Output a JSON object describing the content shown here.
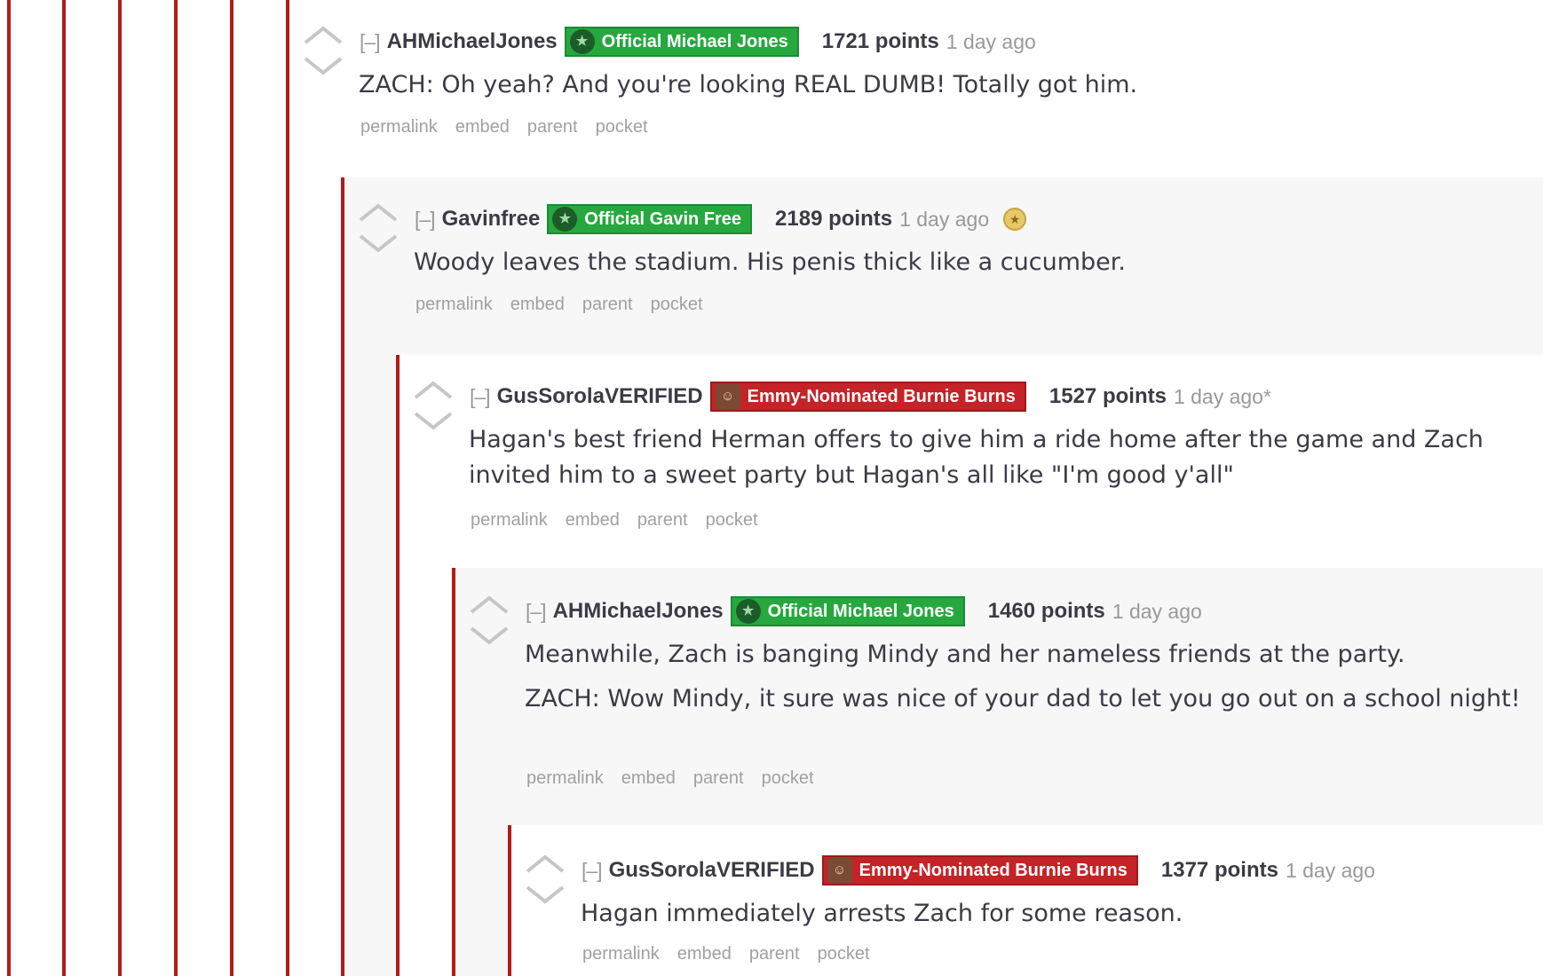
{
  "comments": [
    {
      "collapse": "[–]",
      "author": "AHMichaelJones",
      "flair": "Official Michael Jones",
      "flair_color": "#26a83f",
      "points": "1721 points",
      "time": "1 day ago",
      "body": [
        "ZACH: Oh yeah? And you're looking REAL DUMB! Totally got him."
      ],
      "actions": [
        "permalink",
        "embed",
        "parent",
        "pocket"
      ]
    },
    {
      "collapse": "[–]",
      "author": "Gavinfree",
      "flair": "Official Gavin Free",
      "flair_color": "#26a83f",
      "points": "2189 points",
      "time": "1 day ago",
      "body": [
        "Woody leaves the stadium. His penis thick like a cucumber."
      ],
      "actions": [
        "permalink",
        "embed",
        "parent",
        "pocket"
      ]
    },
    {
      "collapse": "[–]",
      "author": "GusSorolaVERIFIED",
      "flair": "Emmy-Nominated Burnie Burns",
      "flair_color": "#c42327",
      "points": "1527 points",
      "time": "1 day ago*",
      "body": [
        "Hagan's best friend Herman offers to give him a ride home after the game and Zach invited him to a sweet party but Hagan's all like \"I'm good y'all\""
      ],
      "actions": [
        "permalink",
        "embed",
        "parent",
        "pocket"
      ]
    },
    {
      "collapse": "[–]",
      "author": "AHMichaelJones",
      "flair": "Official Michael Jones",
      "flair_color": "#26a83f",
      "points": "1460 points",
      "time": "1 day ago",
      "body": [
        "Meanwhile, Zach is banging Mindy and her nameless friends at the party.",
        "ZACH: Wow Mindy, it sure was nice of your dad to let you go out on a school night!"
      ],
      "actions": [
        "permalink",
        "embed",
        "parent",
        "pocket"
      ]
    },
    {
      "collapse": "[–]",
      "author": "GusSorolaVERIFIED",
      "flair": "Emmy-Nominated Burnie Burns",
      "flair_color": "#c42327",
      "points": "1377 points",
      "time": "1 day ago",
      "body": [
        "Hagan immediately arrests Zach for some reason."
      ],
      "actions": [
        "permalink",
        "embed",
        "parent",
        "pocket"
      ]
    }
  ],
  "icons": {
    "upvote": "upvote-arrow-icon",
    "downvote": "downvote-arrow-icon",
    "award": "gold-award-icon",
    "flair_green": "achievement-hunter-logo-icon",
    "flair_red": "burnie-avatar-icon"
  }
}
